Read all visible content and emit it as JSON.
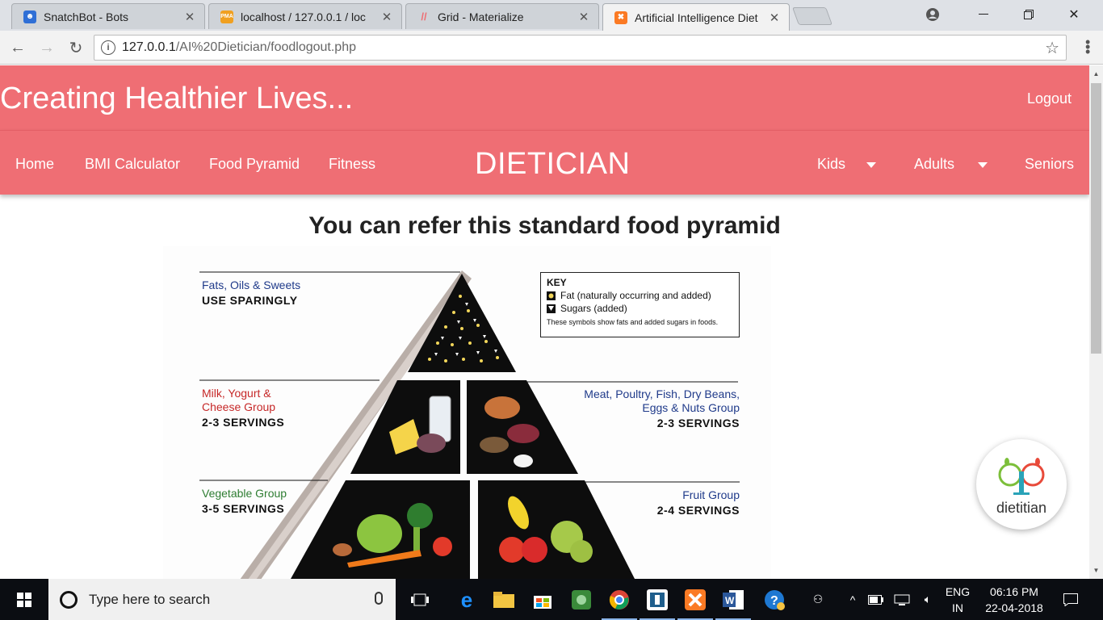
{
  "browser": {
    "tabs": [
      {
        "title": "SnatchBot - Bots",
        "favicon": "snatchbot-icon",
        "favicon_color": "#2f6fd6"
      },
      {
        "title": "localhost / 127.0.0.1 / loc",
        "favicon": "phpmyadmin-icon",
        "favicon_color": "#f0a020"
      },
      {
        "title": "Grid - Materialize",
        "favicon": "materialize-icon",
        "favicon_color": "#ee6e73"
      },
      {
        "title": "Artificial Intelligence Diet",
        "favicon": "xampp-icon",
        "favicon_color": "#fb7a24"
      }
    ],
    "url_host": "127.0.0.1",
    "url_path": "/AI%20Dietician/foodlogout.php"
  },
  "page": {
    "brand": "Creating Healthier Lives...",
    "logout": "Logout",
    "nav": {
      "home": "Home",
      "bmi": "BMI Calculator",
      "pyramid": "Food Pyramid",
      "fitness": "Fitness",
      "logo": "DIETICIAN",
      "kids": "Kids",
      "adults": "Adults",
      "seniors": "Seniors"
    },
    "heading": "You can refer this standard food pyramid",
    "pyramid": {
      "fats": {
        "name": "Fats, Oils & Sweets",
        "servings": "USE SPARINGLY"
      },
      "milk": {
        "name1": "Milk, Yogurt &",
        "name2": "Cheese Group",
        "servings": "2-3 SERVINGS"
      },
      "meat": {
        "name1": "Meat, Poultry, Fish, Dry Beans,",
        "name2": "Eggs & Nuts Group",
        "servings": "2-3 SERVINGS"
      },
      "veg": {
        "name": "Vegetable Group",
        "servings": "3-5 SERVINGS"
      },
      "fruit": {
        "name": "Fruit Group",
        "servings": "2-4 SERVINGS"
      },
      "key": {
        "title": "KEY",
        "fat": "Fat (naturally occurring and added)",
        "sugar": "Sugars (added)",
        "note": "These symbols show fats and added sugars in foods."
      }
    },
    "bot_label": "dietitian",
    "colors": {
      "accent": "#ef6e74",
      "blue_label": "#1f3a8a",
      "red_label": "#c62828",
      "green_label": "#2e7d32"
    }
  },
  "taskbar": {
    "search_placeholder": "Type here to search",
    "lang1": "ENG",
    "lang2": "IN",
    "time": "06:16 PM",
    "date": "22-04-2018"
  }
}
